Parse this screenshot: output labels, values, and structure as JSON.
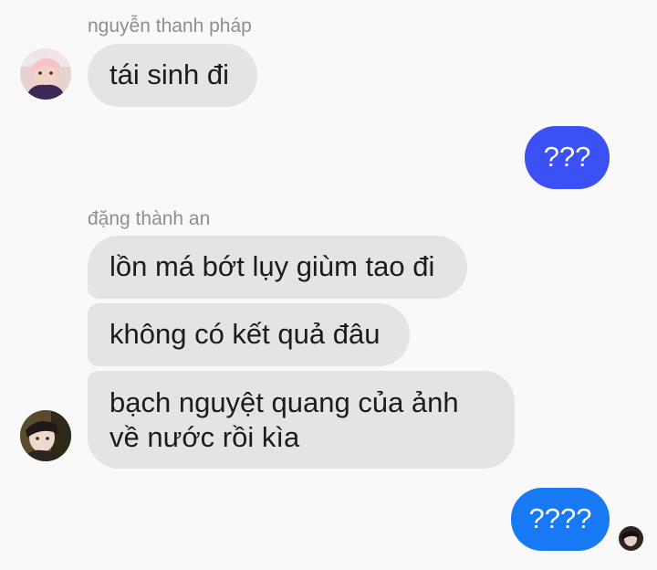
{
  "thread": {
    "groups": [
      {
        "sender": "nguyễn thanh pháp",
        "messages": [
          "tái sinh đi"
        ]
      },
      {
        "outgoing": [
          "???"
        ]
      },
      {
        "sender": "đặng thành an",
        "messages": [
          "lồn má bớt lụy giùm tao đi",
          "không có kết quả đâu",
          "bạch nguyệt quang của ảnh",
          "về nước rồi kìa"
        ]
      },
      {
        "outgoing": [
          "????"
        ]
      }
    ]
  },
  "colors": {
    "outgoing_bubble_1": "#3b50f5",
    "outgoing_bubble_2": "#1779f3",
    "incoming_bubble": "#e4e4e6",
    "sender_name": "#8e8e93"
  },
  "icons": [
    "avatar-nguyen-thanh-phap",
    "avatar-dang-thanh-an",
    "seen-avatar"
  ]
}
